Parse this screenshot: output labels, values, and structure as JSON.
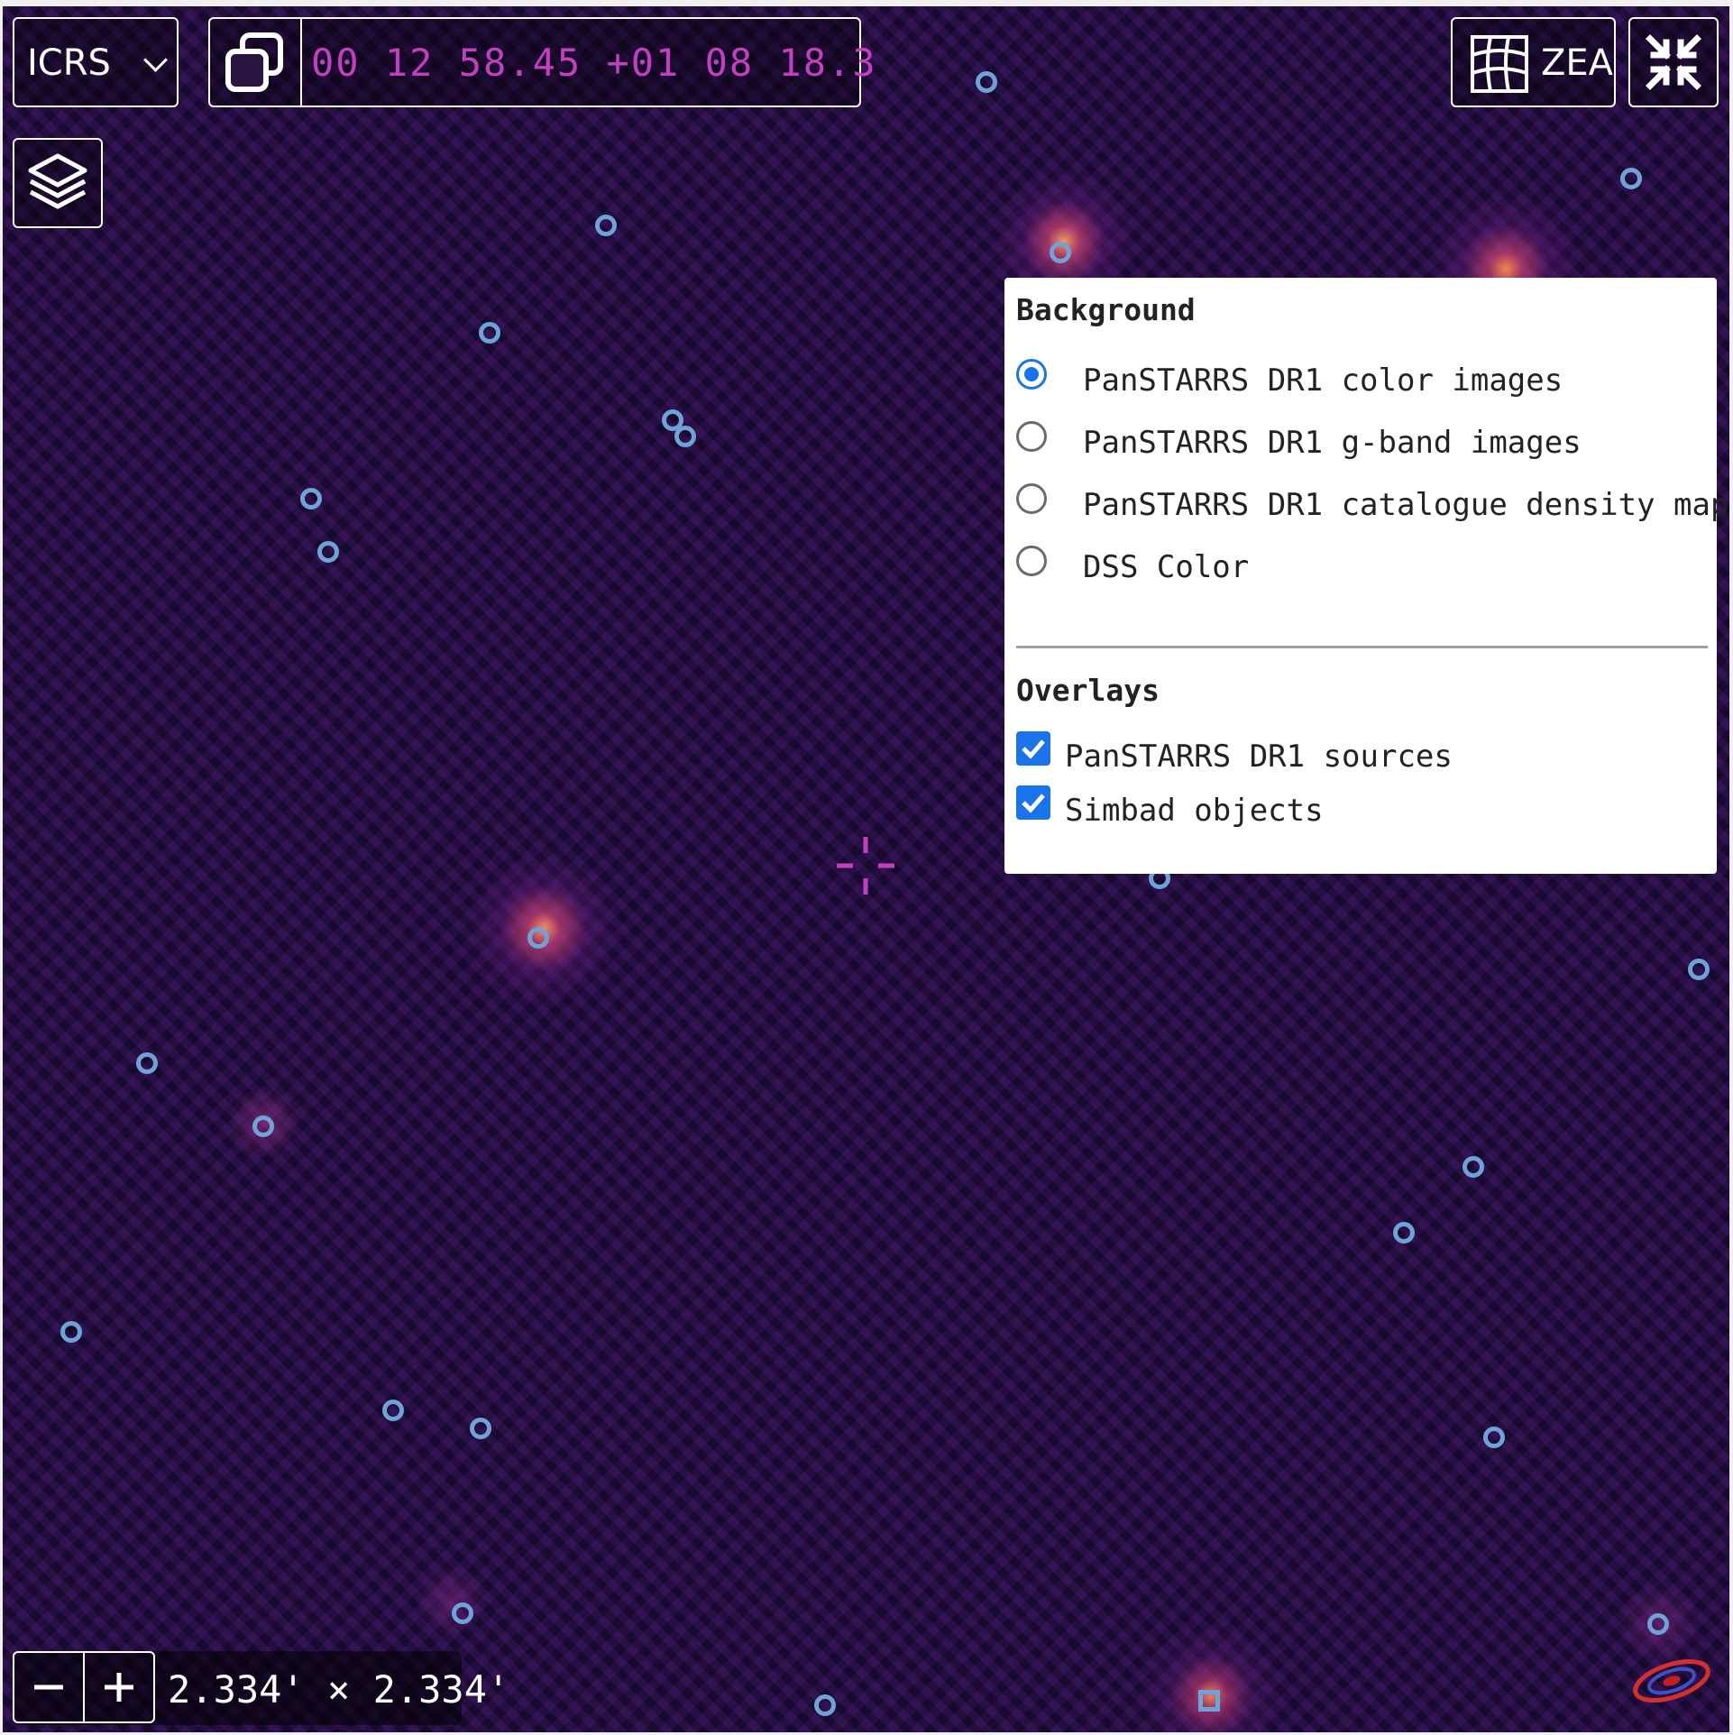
{
  "frame": {
    "value": "ICRS"
  },
  "coordinates": {
    "text": "00 12 58.45 +01 08 18.3"
  },
  "projection": {
    "label": "ZEA"
  },
  "fov": {
    "text": "2.334' × 2.334'"
  },
  "layers_panel": {
    "background_heading": "Background",
    "background_options": [
      {
        "label": "PanSTARRS DR1 color images",
        "selected": true
      },
      {
        "label": "PanSTARRS DR1 g-band images",
        "selected": false
      },
      {
        "label": "PanSTARRS DR1 catalogue density map",
        "selected": false
      },
      {
        "label": "DSS Color",
        "selected": false
      }
    ],
    "overlays_heading": "Overlays",
    "overlays": [
      {
        "label": "PanSTARRS DR1 sources",
        "checked": true
      },
      {
        "label": "Simbad objects",
        "checked": true
      }
    ]
  },
  "colors": {
    "coordinates_text": "#c040c0",
    "source_marker": "#6fa3d8",
    "accent": "#1a73e8",
    "sky_background": "#26103f"
  },
  "icons": [
    "chevron-down-icon",
    "copy-icon",
    "grid-projection-icon",
    "fullscreen-exit-icon",
    "layers-icon",
    "crosshair-icon",
    "minus-icon",
    "plus-icon",
    "aladin-logo-icon"
  ]
}
